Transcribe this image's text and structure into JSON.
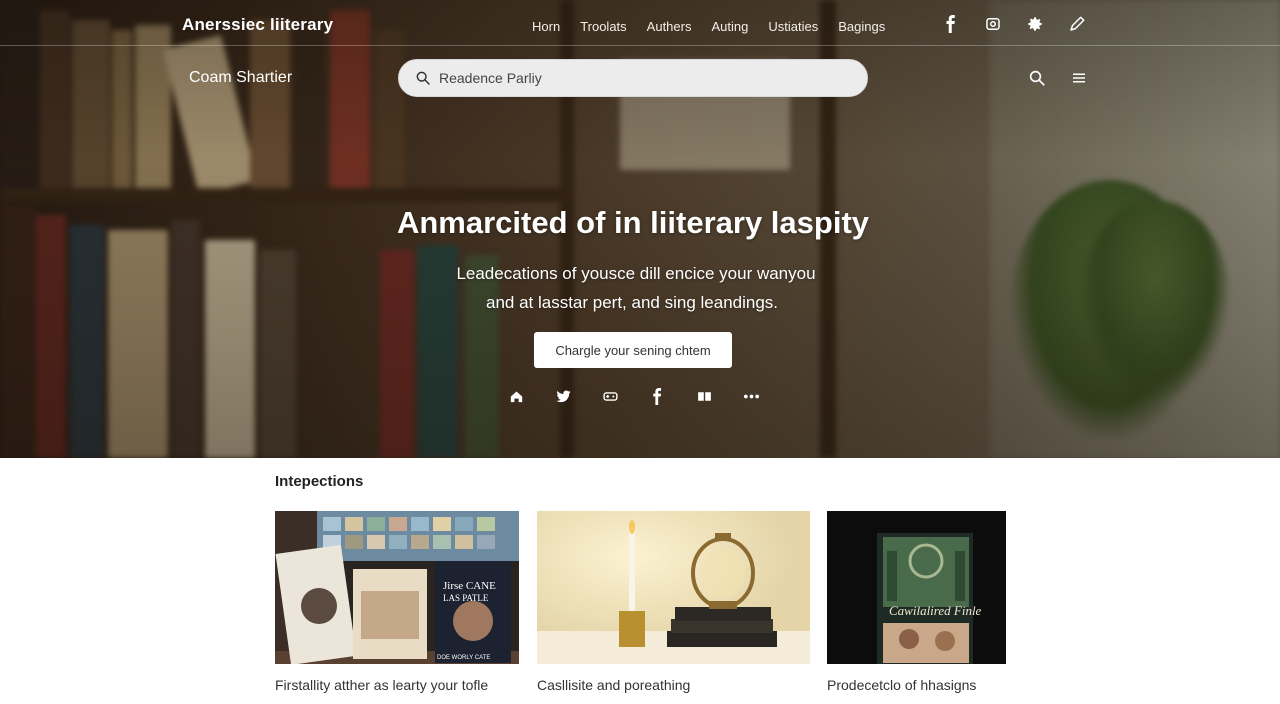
{
  "brand": "Anerssiec liiterary",
  "nav": {
    "links": [
      "Horn",
      "Troolats",
      "Authers",
      "Auting",
      "Ustiaties",
      "Bagings"
    ],
    "icons": [
      "facebook-icon",
      "refresh-icon",
      "gear-icon",
      "edit-icon"
    ]
  },
  "subtitle": "Coam Shartier",
  "search": {
    "placeholder": "Readence Parliy"
  },
  "hero": {
    "title": "Anmarcited of in liiterary laspity",
    "line1": "Leadecations of yousce dill encice your wanyou",
    "line2": "and at lasstar pert, and sing leandings.",
    "cta": "Chargle your sening chtem",
    "social_icons": [
      "home-icon",
      "twitter-icon",
      "gamepad-icon",
      "facebook-icon",
      "book-icon",
      "more-icon"
    ]
  },
  "section": {
    "title": "Intepections",
    "cards": [
      {
        "caption": "Firstallity atther as learty your tofle",
        "cover1": "Jirse CANE",
        "cover2": "LAS PATLE",
        "cover3": "DOE WORLY CATE"
      },
      {
        "caption": "Casllisite and poreathing"
      },
      {
        "caption": "Prodecetclo of hhasigns",
        "cover_title": "Cawilalired Finle"
      }
    ]
  },
  "colors": {
    "hero_dark": "#2a1d14",
    "accent_white": "#ffffff",
    "search_bg": "#ececec"
  }
}
